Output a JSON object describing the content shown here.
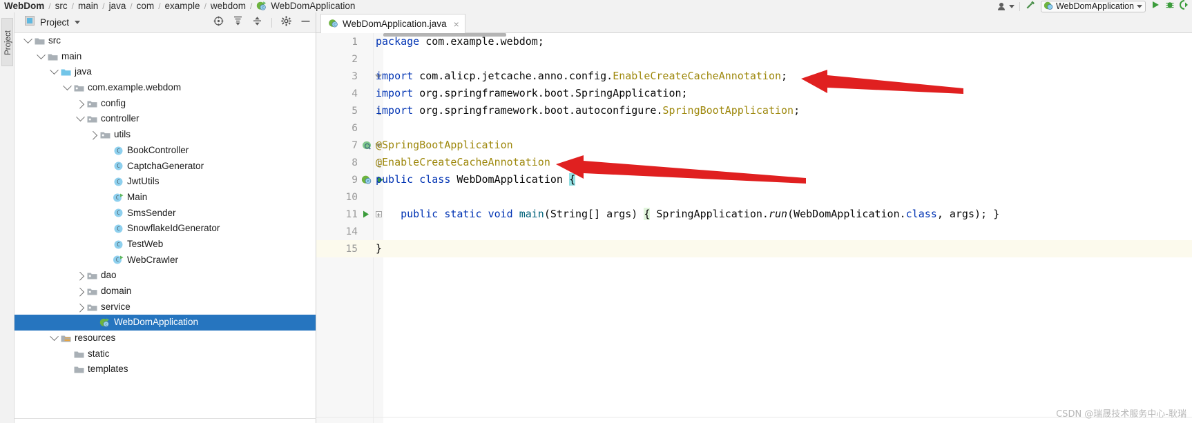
{
  "navbar": {
    "breadcrumb": [
      {
        "label": "WebDom",
        "bold": true,
        "icon": ""
      },
      {
        "label": "src",
        "bold": false,
        "icon": ""
      },
      {
        "label": "main",
        "bold": false,
        "icon": ""
      },
      {
        "label": "java",
        "bold": false,
        "icon": ""
      },
      {
        "label": "com",
        "bold": false,
        "icon": ""
      },
      {
        "label": "example",
        "bold": false,
        "icon": ""
      },
      {
        "label": "webdom",
        "bold": false,
        "icon": ""
      },
      {
        "label": "WebDomApplication",
        "bold": false,
        "icon": "spring-class-icon"
      }
    ],
    "separator": "/",
    "right": {
      "user_icon": "user-icon",
      "build_icon": "hammer-icon",
      "run_config_label": "WebDomApplication",
      "run_config_icon": "spring-boot-icon",
      "run_icon": "run-icon",
      "debug_icon": "debug-icon",
      "coverage_icon": "run-with-coverage-icon"
    }
  },
  "toolstrip": {
    "project_tab_label": "Project"
  },
  "project_panel": {
    "title": "Project",
    "title_icon": "project-view-icon",
    "dropdown_icon": "chevron-down-icon",
    "actions": [
      {
        "name": "select-opened-file-icon",
        "label": ""
      },
      {
        "name": "expand-all-icon",
        "label": ""
      },
      {
        "name": "collapse-all-icon",
        "label": ""
      },
      {
        "name": "settings-gear-icon",
        "label": ""
      },
      {
        "name": "hide-panel-icon",
        "label": ""
      }
    ],
    "tree": [
      {
        "label": "src",
        "indent": 1,
        "twisty": "down",
        "icon": "folder-icon",
        "selected": false
      },
      {
        "label": "main",
        "indent": 2,
        "twisty": "down",
        "icon": "folder-icon",
        "selected": false
      },
      {
        "label": "java",
        "indent": 3,
        "twisty": "down",
        "icon": "source-folder-icon",
        "selected": false
      },
      {
        "label": "com.example.webdom",
        "indent": 4,
        "twisty": "down",
        "icon": "package-icon",
        "selected": false
      },
      {
        "label": "config",
        "indent": 5,
        "twisty": "right",
        "icon": "package-icon",
        "selected": false
      },
      {
        "label": "controller",
        "indent": 5,
        "twisty": "down",
        "icon": "package-icon",
        "selected": false
      },
      {
        "label": "utils",
        "indent": 6,
        "twisty": "right",
        "icon": "package-icon",
        "selected": false
      },
      {
        "label": "BookController",
        "indent": 7,
        "twisty": "none",
        "icon": "java-class-icon",
        "selected": false
      },
      {
        "label": "CaptchaGenerator",
        "indent": 7,
        "twisty": "none",
        "icon": "java-class-icon",
        "selected": false
      },
      {
        "label": "JwtUtils",
        "indent": 7,
        "twisty": "none",
        "icon": "java-class-icon",
        "selected": false
      },
      {
        "label": "Main",
        "indent": 7,
        "twisty": "none",
        "icon": "runnable-class-icon",
        "selected": false
      },
      {
        "label": "SmsSender",
        "indent": 7,
        "twisty": "none",
        "icon": "java-class-icon",
        "selected": false
      },
      {
        "label": "SnowflakeIdGenerator",
        "indent": 7,
        "twisty": "none",
        "icon": "java-class-icon",
        "selected": false
      },
      {
        "label": "TestWeb",
        "indent": 7,
        "twisty": "none",
        "icon": "java-class-icon",
        "selected": false
      },
      {
        "label": "WebCrawler",
        "indent": 7,
        "twisty": "none",
        "icon": "runnable-class-icon",
        "selected": false
      },
      {
        "label": "dao",
        "indent": 5,
        "twisty": "right",
        "icon": "package-icon",
        "selected": false
      },
      {
        "label": "domain",
        "indent": 5,
        "twisty": "right",
        "icon": "package-icon",
        "selected": false
      },
      {
        "label": "service",
        "indent": 5,
        "twisty": "right",
        "icon": "package-icon",
        "selected": false
      },
      {
        "label": "WebDomApplication",
        "indent": 6,
        "twisty": "none",
        "icon": "spring-class-icon",
        "selected": true
      },
      {
        "label": "resources",
        "indent": 3,
        "twisty": "down",
        "icon": "resources-folder-icon",
        "selected": false
      },
      {
        "label": "static",
        "indent": 4,
        "twisty": "none",
        "icon": "folder-icon",
        "selected": false
      },
      {
        "label": "templates",
        "indent": 4,
        "twisty": "none",
        "icon": "folder-icon",
        "selected": false
      }
    ]
  },
  "editor": {
    "tab": {
      "label": "WebDomApplication.java",
      "icon": "spring-class-icon",
      "close_label": "×"
    },
    "lines": [
      {
        "no": "1",
        "gutter": [],
        "fold": "none",
        "current": false,
        "tokens": [
          {
            "t": "package ",
            "c": "kw"
          },
          {
            "t": "com.example.webdom;",
            "c": "plain"
          }
        ]
      },
      {
        "no": "2",
        "gutter": [],
        "fold": "none",
        "current": false,
        "tokens": []
      },
      {
        "no": "3",
        "gutter": [],
        "fold": "arrow",
        "current": false,
        "tokens": [
          {
            "t": "import ",
            "c": "kw"
          },
          {
            "t": "com.alicp.jetcache.anno.config.",
            "c": "plain"
          },
          {
            "t": "EnableCreateCacheAnnotation",
            "c": "cls"
          },
          {
            "t": ";",
            "c": "plain"
          }
        ]
      },
      {
        "no": "4",
        "gutter": [],
        "fold": "none",
        "current": false,
        "tokens": [
          {
            "t": "import ",
            "c": "kw"
          },
          {
            "t": "org.springframework.boot.SpringApplication;",
            "c": "plain"
          }
        ]
      },
      {
        "no": "5",
        "gutter": [],
        "fold": "end",
        "current": false,
        "tokens": [
          {
            "t": "import ",
            "c": "kw"
          },
          {
            "t": "org.springframework.boot.autoconfigure.",
            "c": "plain"
          },
          {
            "t": "SpringBootApplication",
            "c": "cls"
          },
          {
            "t": ";",
            "c": "plain"
          }
        ]
      },
      {
        "no": "6",
        "gutter": [],
        "fold": "none",
        "current": false,
        "tokens": []
      },
      {
        "no": "7",
        "gutter": [
          "spring-bean-icon"
        ],
        "fold": "arrow",
        "current": false,
        "tokens": [
          {
            "t": "@SpringBootApplication",
            "c": "anno"
          }
        ]
      },
      {
        "no": "8",
        "gutter": [],
        "fold": "end",
        "current": false,
        "tokens": [
          {
            "t": "@EnableCreateCacheAnnotation",
            "c": "anno"
          }
        ]
      },
      {
        "no": "9",
        "gutter": [
          "spring-boot-icon",
          "run-icon"
        ],
        "fold": "none",
        "current": false,
        "tokens": [
          {
            "t": "public ",
            "c": "kw"
          },
          {
            "t": "class ",
            "c": "kw"
          },
          {
            "t": "WebDomApplication ",
            "c": "plain"
          },
          {
            "t": "{",
            "c": "brace-hl"
          }
        ]
      },
      {
        "no": "10",
        "gutter": [],
        "fold": "none",
        "current": false,
        "tokens": []
      },
      {
        "no": "11",
        "gutter": [
          "run-icon"
        ],
        "fold": "plusbox",
        "current": false,
        "tokens": [
          {
            "t": "    public ",
            "c": "kw"
          },
          {
            "t": "static ",
            "c": "kw"
          },
          {
            "t": "void ",
            "c": "kw"
          },
          {
            "t": "main",
            "c": "meth"
          },
          {
            "t": "(String[] args) ",
            "c": "plain"
          },
          {
            "t": "{",
            "c": "brace-gr"
          },
          {
            "t": " SpringApplication.",
            "c": "plain"
          },
          {
            "t": "run",
            "c": "plain ital"
          },
          {
            "t": "(WebDomApplication.",
            "c": "plain"
          },
          {
            "t": "class",
            "c": "kw"
          },
          {
            "t": ", args); }",
            "c": "plain"
          }
        ]
      },
      {
        "no": "14",
        "gutter": [],
        "fold": "none",
        "current": false,
        "tokens": []
      },
      {
        "no": "15",
        "gutter": [],
        "fold": "none",
        "current": true,
        "tokens": [
          {
            "t": "}",
            "c": "plain"
          }
        ]
      }
    ]
  },
  "annotations": {
    "arrow_color": "#e02020",
    "arrows": [
      {
        "name": "arrow-pointing-to-import-line"
      },
      {
        "name": "arrow-pointing-to-annotation-line"
      }
    ]
  },
  "watermark": {
    "text": "CSDN @瑞晟技术服务中心-耿瑞"
  },
  "colors": {
    "selection_blue": "#2675bf",
    "keyword_blue": "#0033b3",
    "class_yellow": "#9e880d",
    "method_teal": "#00627a",
    "current_line": "#fcfaed",
    "arrow_red": "#e02020"
  }
}
